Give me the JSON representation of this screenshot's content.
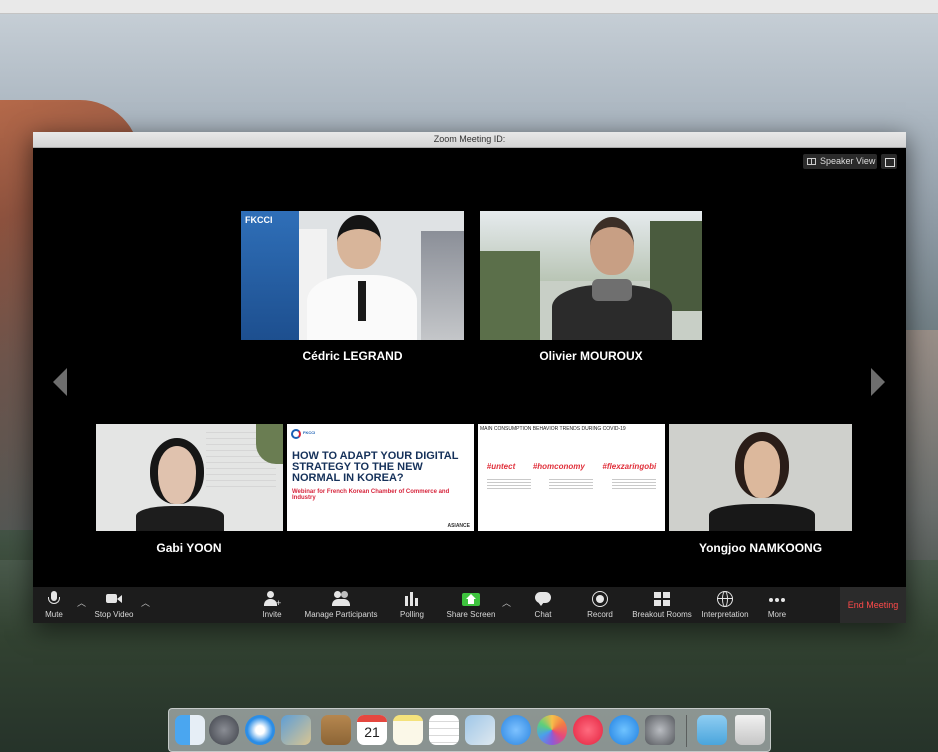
{
  "window": {
    "title": "Zoom Meeting ID:"
  },
  "view": {
    "speaker_view_label": "Speaker View"
  },
  "participants": [
    {
      "name": "Cédric LEGRAND"
    },
    {
      "name": "Olivier MOUROUX"
    },
    {
      "name": "Gabi YOON"
    },
    {
      "name": "Yongjoo NAMKOONG"
    }
  ],
  "shared_slides": {
    "slide1": {
      "logo_text": "FKCCI",
      "title": "HOW TO ADAPT YOUR DIGITAL STRATEGY TO THE NEW NORMAL IN KOREA?",
      "subtitle": "Webinar for French Korean Chamber of Commerce and Industry",
      "brand": "ASIANCE"
    },
    "slide2": {
      "title": "MAIN CONSUMPTION BEHAVIOR TRENDS DURING COVID-19",
      "tags": [
        "#untect",
        "#homconomy",
        "#flexzaringobi"
      ]
    },
    "background_sign": "FKCCI"
  },
  "toolbar": {
    "mute": "Mute",
    "stop_video": "Stop Video",
    "invite": "Invite",
    "manage_participants": "Manage Participants",
    "polling": "Polling",
    "share_screen": "Share Screen",
    "chat": "Chat",
    "record": "Record",
    "breakout_rooms": "Breakout Rooms",
    "interpretation": "Interpretation",
    "more": "More",
    "end_meeting": "End Meeting"
  },
  "dock": {
    "calendar_day": "21",
    "icons": [
      "finder-icon",
      "launchpad-icon",
      "safari-icon",
      "mail-icon",
      "contacts-icon",
      "calendar-icon",
      "notes-icon",
      "reminders-icon",
      "preview-icon",
      "messages-icon",
      "photos-icon",
      "music-icon",
      "app-store-icon",
      "system-preferences-icon",
      "downloads-folder-icon",
      "trash-icon"
    ]
  },
  "colors": {
    "end_meeting": "#ff4a4a",
    "toolbar_bg": "#1c1c1c",
    "share_screen": "#3ec33e"
  }
}
